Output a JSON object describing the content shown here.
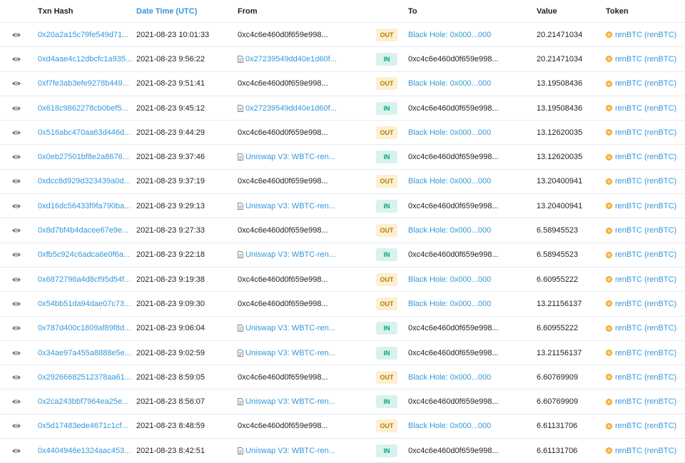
{
  "columns": {
    "txn_hash": "Txn Hash",
    "date_time": "Date Time (UTC)",
    "from": "From",
    "to": "To",
    "value": "Value",
    "token": "Token"
  },
  "colors": {
    "link": "#3498db",
    "out_badge_bg": "#fcefd2",
    "out_badge_text": "#b47d00",
    "in_badge_bg": "#d8f3ec",
    "in_badge_text": "#00a186",
    "token_icon": "#f5a623"
  },
  "rows": [
    {
      "hash": "0x20a2a15c79fe549d71...",
      "date": "2021-08-23 10:01:33",
      "from": "0xc4c6e460d0f659e998...",
      "from_contract": false,
      "direction": "OUT",
      "to": "Black Hole: 0x000...000",
      "to_link": true,
      "value": "20.21471034",
      "token": "renBTC (renBTC)"
    },
    {
      "hash": "0xd4aae4c12dbcfc1a935...",
      "date": "2021-08-23 9:56:22",
      "from": "0x27239549dd40e1d60f...",
      "from_contract": true,
      "direction": "IN",
      "to": "0xc4c6e460d0f659e998...",
      "to_link": false,
      "value": "20.21471034",
      "token": "renBTC (renBTC)"
    },
    {
      "hash": "0xf7fe3ab3efe9278b449...",
      "date": "2021-08-23 9:51:41",
      "from": "0xc4c6e460d0f659e998...",
      "from_contract": false,
      "direction": "OUT",
      "to": "Black Hole: 0x000...000",
      "to_link": true,
      "value": "13.19508436",
      "token": "renBTC (renBTC)"
    },
    {
      "hash": "0x618c9862278cb0bef5...",
      "date": "2021-08-23 9:45:12",
      "from": "0x27239549dd40e1d60f...",
      "from_contract": true,
      "direction": "IN",
      "to": "0xc4c6e460d0f659e998...",
      "to_link": false,
      "value": "13.19508436",
      "token": "renBTC (renBTC)"
    },
    {
      "hash": "0x516abc470aa63d446d...",
      "date": "2021-08-23 9:44:29",
      "from": "0xc4c6e460d0f659e998...",
      "from_contract": false,
      "direction": "OUT",
      "to": "Black Hole: 0x000...000",
      "to_link": true,
      "value": "13.12620035",
      "token": "renBTC (renBTC)"
    },
    {
      "hash": "0x0eb27501bf8e2a8676...",
      "date": "2021-08-23 9:37:46",
      "from": "Uniswap V3: WBTC-ren...",
      "from_contract": true,
      "direction": "IN",
      "to": "0xc4c6e460d0f659e998...",
      "to_link": false,
      "value": "13.12620035",
      "token": "renBTC (renBTC)"
    },
    {
      "hash": "0xdcc8d929d323439a0d...",
      "date": "2021-08-23 9:37:19",
      "from": "0xc4c6e460d0f659e998...",
      "from_contract": false,
      "direction": "OUT",
      "to": "Black Hole: 0x000...000",
      "to_link": true,
      "value": "13.20400941",
      "token": "renBTC (renBTC)"
    },
    {
      "hash": "0xd16dc56433f9fa790ba...",
      "date": "2021-08-23 9:29:13",
      "from": "Uniswap V3: WBTC-ren...",
      "from_contract": true,
      "direction": "IN",
      "to": "0xc4c6e460d0f659e998...",
      "to_link": false,
      "value": "13.20400941",
      "token": "renBTC (renBTC)"
    },
    {
      "hash": "0x8d7bf4b4dacee67e9e...",
      "date": "2021-08-23 9:27:33",
      "from": "0xc4c6e460d0f659e998...",
      "from_contract": false,
      "direction": "OUT",
      "to": "Black Hole: 0x000...000",
      "to_link": true,
      "value": "6.58945523",
      "token": "renBTC (renBTC)"
    },
    {
      "hash": "0xfb5c924c6adca6e0f6a...",
      "date": "2021-08-23 9:22:18",
      "from": "Uniswap V3: WBTC-ren...",
      "from_contract": true,
      "direction": "IN",
      "to": "0xc4c6e460d0f659e998...",
      "to_link": false,
      "value": "6.58945523",
      "token": "renBTC (renBTC)"
    },
    {
      "hash": "0x6872796a4d8cf95d54f...",
      "date": "2021-08-23 9:19:38",
      "from": "0xc4c6e460d0f659e998...",
      "from_contract": false,
      "direction": "OUT",
      "to": "Black Hole: 0x000...000",
      "to_link": true,
      "value": "6.60955222",
      "token": "renBTC (renBTC)"
    },
    {
      "hash": "0x54bb51da94dae07c73...",
      "date": "2021-08-23 9:09:30",
      "from": "0xc4c6e460d0f659e998...",
      "from_contract": false,
      "direction": "OUT",
      "to": "Black Hole: 0x000...000",
      "to_link": true,
      "value": "13.21156137",
      "token": "renBTC (renBTC)"
    },
    {
      "hash": "0x787d400c1809af89f8d...",
      "date": "2021-08-23 9:06:04",
      "from": "Uniswap V3: WBTC-ren...",
      "from_contract": true,
      "direction": "IN",
      "to": "0xc4c6e460d0f659e998...",
      "to_link": false,
      "value": "6.60955222",
      "token": "renBTC (renBTC)"
    },
    {
      "hash": "0x34ae97a455a8888e5e...",
      "date": "2021-08-23 9:02:59",
      "from": "Uniswap V3: WBTC-ren...",
      "from_contract": true,
      "direction": "IN",
      "to": "0xc4c6e460d0f659e998...",
      "to_link": false,
      "value": "13.21156137",
      "token": "renBTC (renBTC)"
    },
    {
      "hash": "0x29266682512378aa61...",
      "date": "2021-08-23 8:59:05",
      "from": "0xc4c6e460d0f659e998...",
      "from_contract": false,
      "direction": "OUT",
      "to": "Black Hole: 0x000...000",
      "to_link": true,
      "value": "6.60769909",
      "token": "renBTC (renBTC)"
    },
    {
      "hash": "0x2ca243bbf7964ea25e...",
      "date": "2021-08-23 8:56:07",
      "from": "Uniswap V3: WBTC-ren...",
      "from_contract": true,
      "direction": "IN",
      "to": "0xc4c6e460d0f659e998...",
      "to_link": false,
      "value": "6.60769909",
      "token": "renBTC (renBTC)"
    },
    {
      "hash": "0x5d17483ede4671c1cf...",
      "date": "2021-08-23 8:48:59",
      "from": "0xc4c6e460d0f659e998...",
      "from_contract": false,
      "direction": "OUT",
      "to": "Black Hole: 0x000...000",
      "to_link": true,
      "value": "6.61131706",
      "token": "renBTC (renBTC)"
    },
    {
      "hash": "0x4404946e1324aac453...",
      "date": "2021-08-23 8:42:51",
      "from": "Uniswap V3: WBTC-ren...",
      "from_contract": true,
      "direction": "IN",
      "to": "0xc4c6e460d0f659e998...",
      "to_link": false,
      "value": "6.61131706",
      "token": "renBTC (renBTC)"
    }
  ]
}
